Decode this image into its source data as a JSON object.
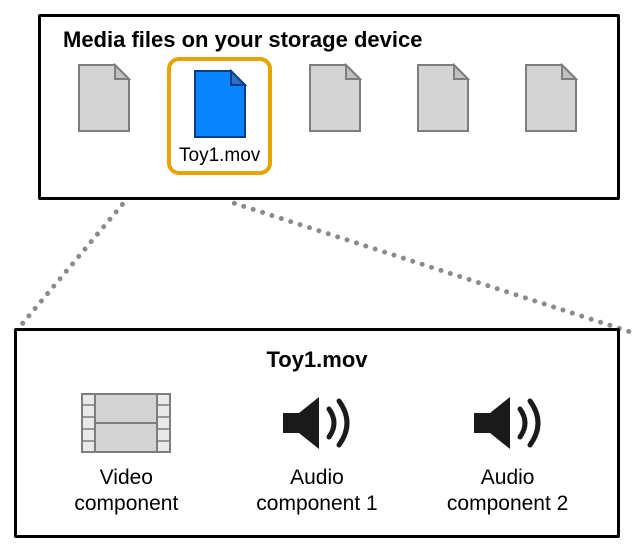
{
  "top": {
    "title": "Media files on your storage device",
    "selected_file_label": "Toy1.mov"
  },
  "bottom": {
    "title": "Toy1.mov",
    "components": {
      "video": "Video\ncomponent",
      "audio1": "Audio\ncomponent 1",
      "audio2": "Audio\ncomponent 2"
    }
  },
  "colors": {
    "highlight": "#e7a400",
    "selected_file_fill": "#0a84ff"
  }
}
